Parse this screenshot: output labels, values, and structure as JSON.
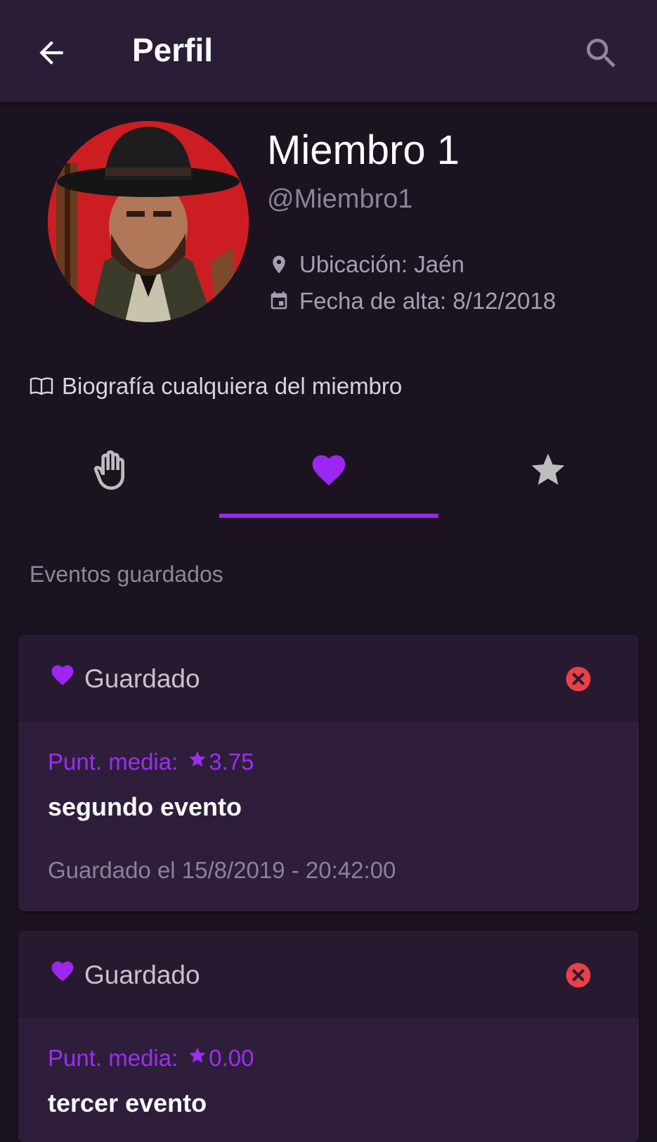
{
  "appbar": {
    "title": "Perfil",
    "back_icon": "arrow-left-icon",
    "search_icon": "search-icon"
  },
  "profile": {
    "name": "Miembro 1",
    "handle": "@Miembro1",
    "location": "Ubicación: Jaén",
    "join_date": "Fecha de alta: 8/12/2018",
    "bio": "Biografía cualquiera del miembro"
  },
  "tabs": [
    {
      "icon": "hand-icon",
      "selected": false
    },
    {
      "icon": "heart-icon",
      "selected": true
    },
    {
      "icon": "star-icon",
      "selected": false
    }
  ],
  "section_label": "Eventos guardados",
  "events": [
    {
      "status": "Guardado",
      "rating_label": "Punt. media:",
      "rating_value": "3.75",
      "name": "segundo evento",
      "saved_at": "Guardado el 15/8/2019 - 20:42:00"
    },
    {
      "status": "Guardado",
      "rating_label": "Punt. media:",
      "rating_value": "0.00",
      "name": "tercer evento"
    }
  ],
  "colors": {
    "accent": "#9b27f0",
    "remove": "#e8414a",
    "appbar": "#2c1d36",
    "background": "#1b1320"
  }
}
